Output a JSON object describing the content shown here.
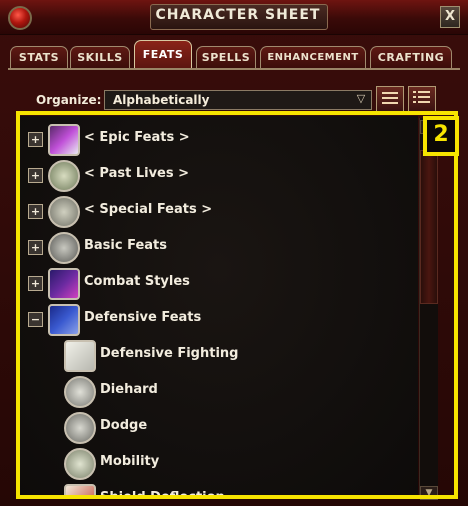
{
  "window": {
    "title": "CHARACTER SHEET",
    "close_label": "X"
  },
  "tabs": [
    {
      "label": "STATS",
      "active": false
    },
    {
      "label": "SKILLS",
      "active": false
    },
    {
      "label": "FEATS",
      "active": true
    },
    {
      "label": "SPELLS",
      "active": false
    },
    {
      "label": "ENHANCEMENT",
      "active": false
    },
    {
      "label": "CRAFTING",
      "active": false
    }
  ],
  "organize": {
    "label": "Organize:",
    "value": "Alphabetically"
  },
  "feat_list": [
    {
      "label": "< Epic Feats >",
      "expander": "+",
      "icon": "epic-feats-icon"
    },
    {
      "label": "< Past Lives >",
      "expander": "+",
      "icon": "past-lives-icon"
    },
    {
      "label": "< Special Feats >",
      "expander": "+",
      "icon": "special-feats-icon"
    },
    {
      "label": "Basic Feats",
      "expander": "+",
      "icon": "basic-feats-icon"
    },
    {
      "label": "Combat Styles",
      "expander": "+",
      "icon": "combat-styles-icon"
    },
    {
      "label": "Defensive Feats",
      "expander": "−",
      "icon": "defensive-feats-icon"
    },
    {
      "label": "Defensive Fighting",
      "icon": "defensive-fighting-icon"
    },
    {
      "label": "Diehard",
      "icon": "diehard-icon"
    },
    {
      "label": "Dodge",
      "icon": "dodge-icon"
    },
    {
      "label": "Mobility",
      "icon": "mobility-icon"
    },
    {
      "label": "Shield Deflection",
      "icon": "shield-deflection-icon"
    }
  ],
  "annotation": {
    "number": "2",
    "color": "#f7e400"
  },
  "colors": {
    "accent": "#8a2418",
    "frame": "#3a0d0b",
    "text": "#f2ecde"
  }
}
